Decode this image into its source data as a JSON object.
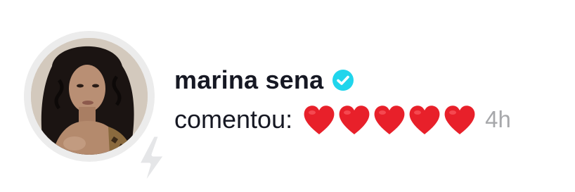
{
  "notification": {
    "username": "marina sena",
    "verified": true,
    "action_label": "comentou:",
    "comment_hearts": 5,
    "timestamp": "4h"
  },
  "icons": {
    "verified": "verified-badge-icon",
    "heart": "red-heart-emoji",
    "badge": "lightning-bolt-icon"
  },
  "colors": {
    "text": "#161823",
    "muted": "#a7a8ab",
    "verified": "#20d5ec",
    "heart": "#e8202a",
    "ring": "#ececec"
  }
}
